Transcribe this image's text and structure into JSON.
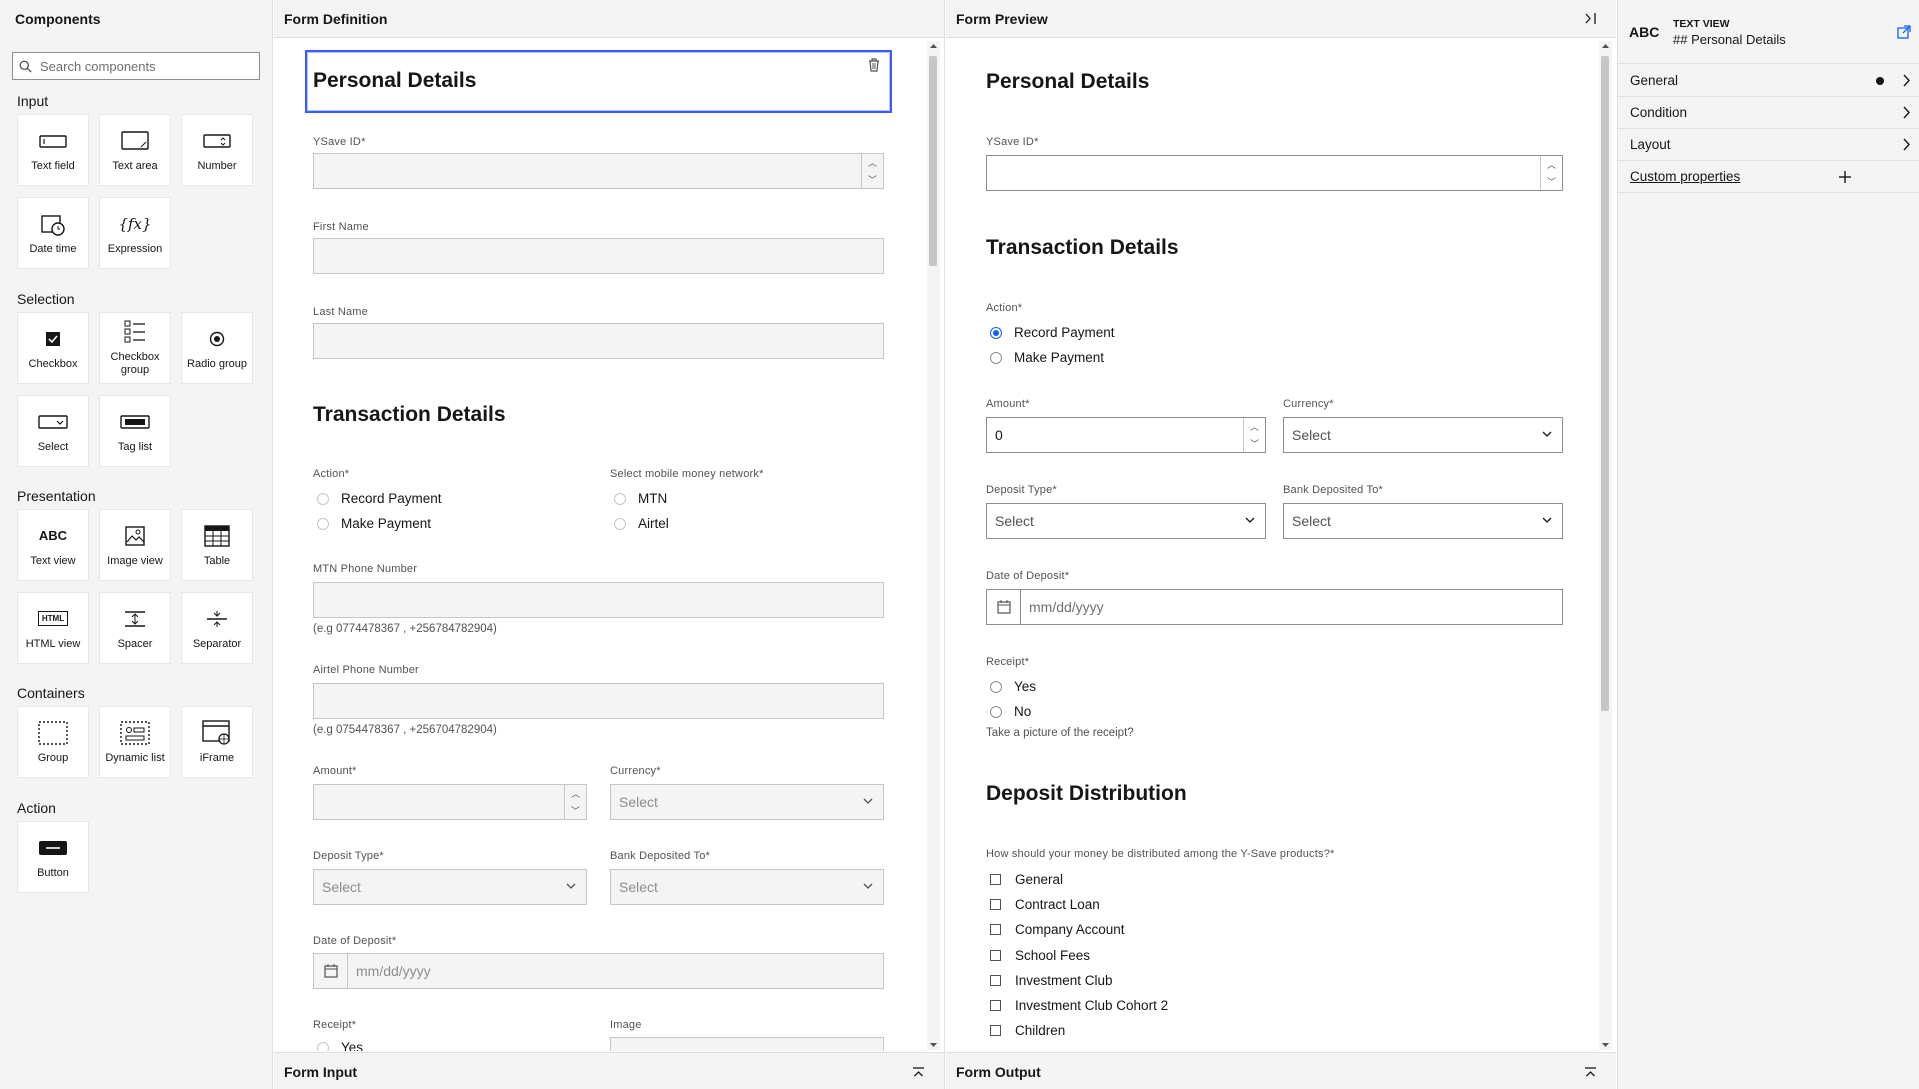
{
  "components": {
    "title": "Components",
    "search_placeholder": "Search components",
    "sections": {
      "input": "Input",
      "selection": "Selection",
      "presentation": "Presentation",
      "containers": "Containers",
      "action": "Action"
    },
    "tiles": {
      "text_field": "Text field",
      "text_area": "Text area",
      "number": "Number",
      "date_time": "Date time",
      "expression": "Expression",
      "checkbox": "Checkbox",
      "checkbox_group": "Checkbox group",
      "radio_group": "Radio group",
      "select": "Select",
      "tag_list": "Tag list",
      "text_view": "Text view",
      "image_view": "Image view",
      "table": "Table",
      "html_view": "HTML view",
      "spacer": "Spacer",
      "separator": "Separator",
      "group": "Group",
      "dynamic_list": "Dynamic list",
      "iframe": "iFrame",
      "button": "Button"
    },
    "icon_text": {
      "abc": "ABC",
      "fx": "{fx}",
      "html": "HTML"
    }
  },
  "definition": {
    "title": "Form Definition",
    "footer": "Form Input",
    "personal_details": "Personal Details",
    "ysave_label": "YSave ID*",
    "first_name_label": "First Name",
    "last_name_label": "Last Name",
    "transaction_details": "Transaction Details",
    "action_label": "Action*",
    "record_payment": "Record Payment",
    "make_payment": "Make Payment",
    "network_label": "Select mobile money network*",
    "mtn": "MTN",
    "airtel": "Airtel",
    "mtn_phone_label": "MTN Phone Number",
    "mtn_help": "(e.g 0774478367 , +256784782904)",
    "airtel_phone_label": "Airtel Phone Number",
    "airtel_help": "(e.g 0754478367 , +256704782904)",
    "amount_label": "Amount*",
    "currency_label": "Currency*",
    "select": "Select",
    "deposit_type_label": "Deposit Type*",
    "bank_label": "Bank Deposited To*",
    "date_label": "Date of Deposit*",
    "date_placeholder": "mm/dd/yyyy",
    "receipt_label": "Receipt*",
    "image_label": "Image",
    "yes_partial": "Yes"
  },
  "preview": {
    "title": "Form Preview",
    "footer": "Form Output",
    "personal_details": "Personal Details",
    "ysave_label": "YSave ID*",
    "transaction_details": "Transaction Details",
    "action_label": "Action*",
    "record_payment": "Record Payment",
    "make_payment": "Make Payment",
    "amount_label": "Amount*",
    "amount_value": "0",
    "currency_label": "Currency*",
    "select": "Select",
    "deposit_type_label": "Deposit Type*",
    "bank_label": "Bank Deposited To*",
    "date_label": "Date of Deposit*",
    "date_placeholder": "mm/dd/yyyy",
    "receipt_label": "Receipt*",
    "yes": "Yes",
    "no": "No",
    "receipt_help": "Take a picture of the receipt?",
    "deposit_distribution": "Deposit Distribution",
    "distribution_question": "How should your money be distributed among the Y-Save products?*",
    "products": [
      "General",
      "Contract Loan",
      "Company Account",
      "School Fees",
      "Investment Club",
      "Investment Club Cohort 2",
      "Children"
    ]
  },
  "properties": {
    "type_icon": "ABC",
    "type_label": "TEXT VIEW",
    "value": "## Personal Details",
    "rows": {
      "general": "General",
      "condition": "Condition",
      "layout": "Layout",
      "custom": "Custom properties"
    }
  },
  "colors": {
    "accent": "#0f62fe",
    "panel": "#f4f4f4",
    "border": "#e0e0e0"
  }
}
